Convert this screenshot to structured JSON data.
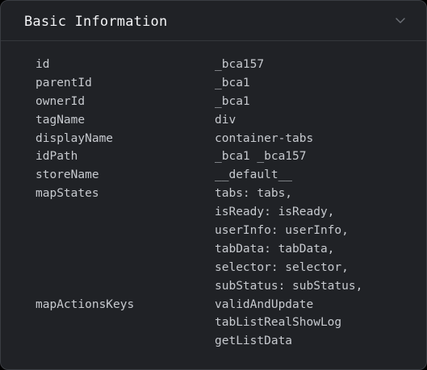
{
  "panel": {
    "title": "Basic Information",
    "collapse_icon": "chevron-down-icon"
  },
  "rows": [
    {
      "key": "id",
      "value": "_bca157"
    },
    {
      "key": "parentId",
      "value": "_bca1"
    },
    {
      "key": "ownerId",
      "value": "_bca1"
    },
    {
      "key": "tagName",
      "value": "div"
    },
    {
      "key": "displayName",
      "value": "container-tabs"
    },
    {
      "key": "idPath",
      "value": "_bca1 _bca157"
    },
    {
      "key": "storeName",
      "value": "__default__"
    },
    {
      "key": "mapStates",
      "value": "tabs: tabs,"
    },
    {
      "key": "",
      "value": "isReady: isReady,"
    },
    {
      "key": "",
      "value": "userInfo: userInfo,"
    },
    {
      "key": "",
      "value": "tabData: tabData,"
    },
    {
      "key": "",
      "value": "selector: selector,"
    },
    {
      "key": "",
      "value": "subStatus: subStatus,"
    },
    {
      "key": "mapActionsKeys",
      "value": "validAndUpdate"
    },
    {
      "key": "",
      "value": "tabListRealShowLog"
    },
    {
      "key": "",
      "value": "getListData"
    }
  ]
}
